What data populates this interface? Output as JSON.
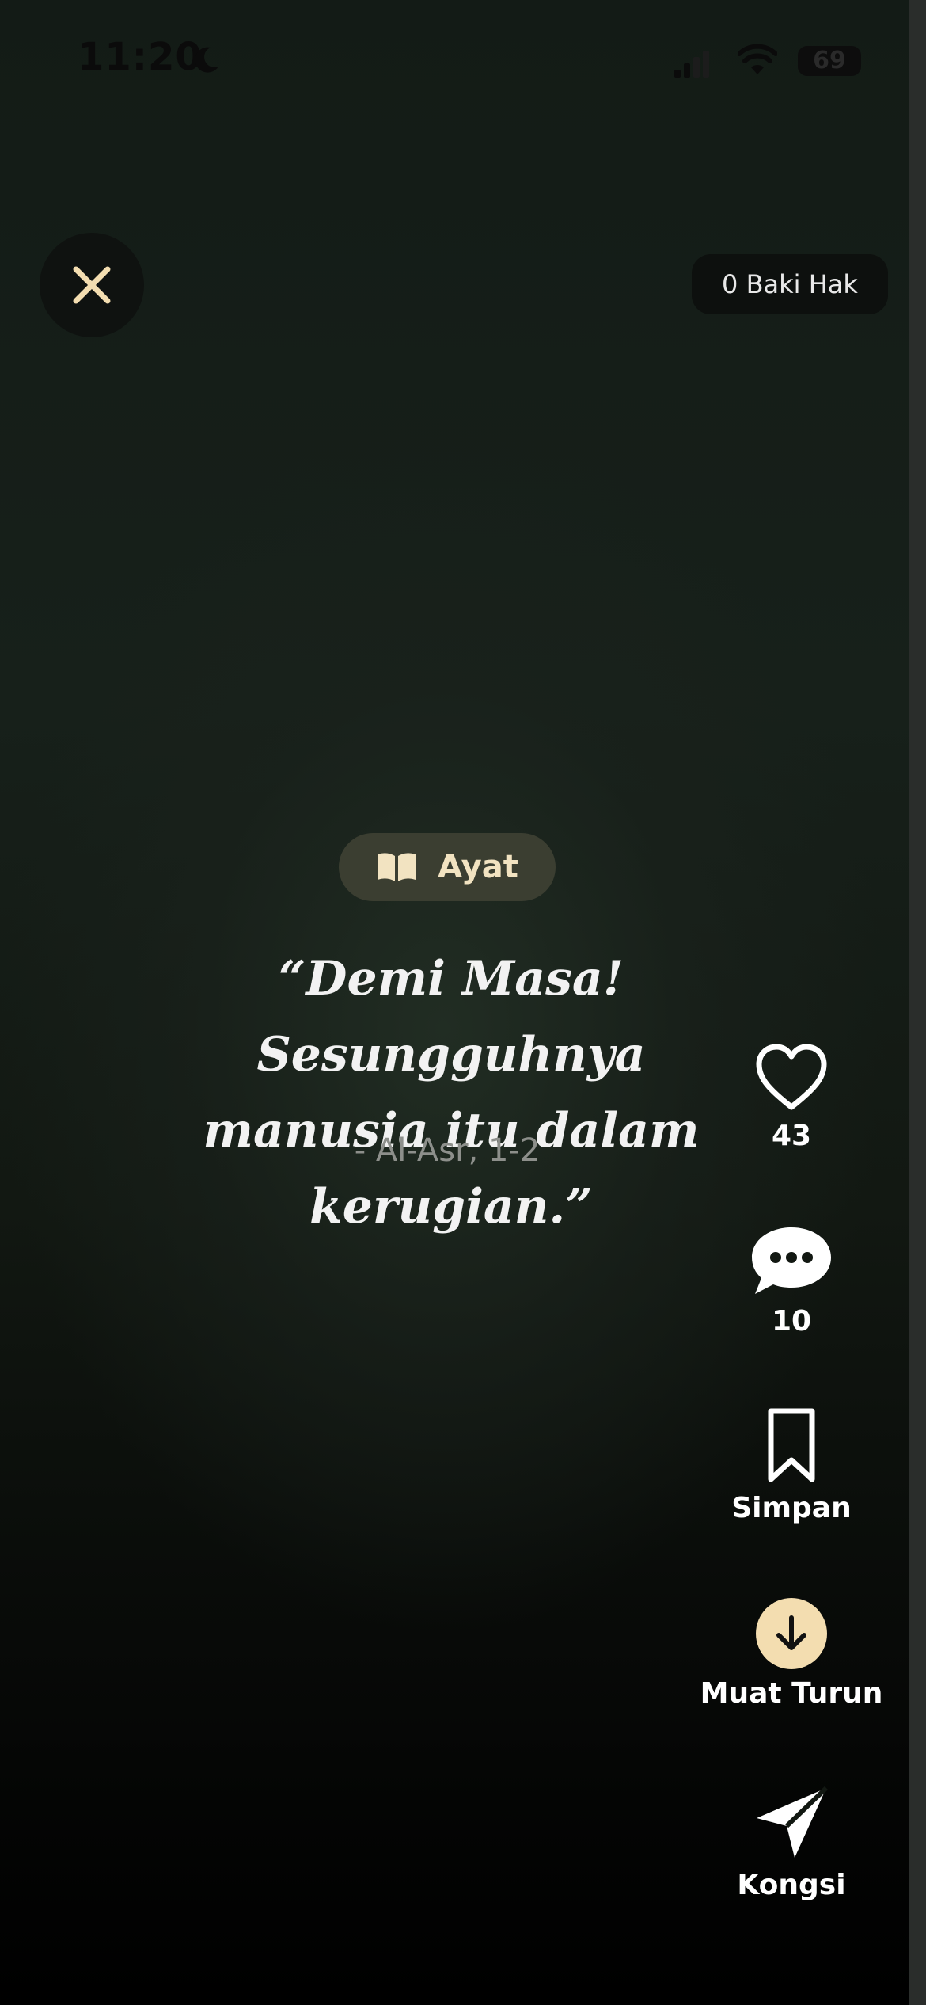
{
  "status_bar": {
    "time": "11:20",
    "battery": "69",
    "icons": [
      "moon-icon",
      "signal-icon",
      "wifi-icon",
      "battery-icon"
    ]
  },
  "header": {
    "close_icon": "close-icon",
    "credit_label": "0 Baki Hak"
  },
  "post": {
    "category_icon": "book-icon",
    "category_label": "Ayat",
    "quote_line1": "“Demi Masa! Sesungguhnya",
    "quote_line2": "manusia itu dalam kerugian.”",
    "reference": "- Al-Asr, 1-2"
  },
  "actions": {
    "like": {
      "icon": "heart-icon",
      "count": "43"
    },
    "comment": {
      "icon": "comment-bubble-icon",
      "count": "10"
    },
    "save": {
      "icon": "bookmark-icon",
      "label": "Simpan"
    },
    "download": {
      "icon": "download-arrow-icon",
      "label": "Muat Turun"
    },
    "share": {
      "icon": "paper-plane-icon",
      "label": "Kongsi"
    }
  },
  "colors": {
    "accent": "#f3ddb0",
    "badge_bg": "#3b3e31",
    "badge_text": "#f2e3c1",
    "background_top": "#131b16",
    "background_bottom": "#000000"
  }
}
